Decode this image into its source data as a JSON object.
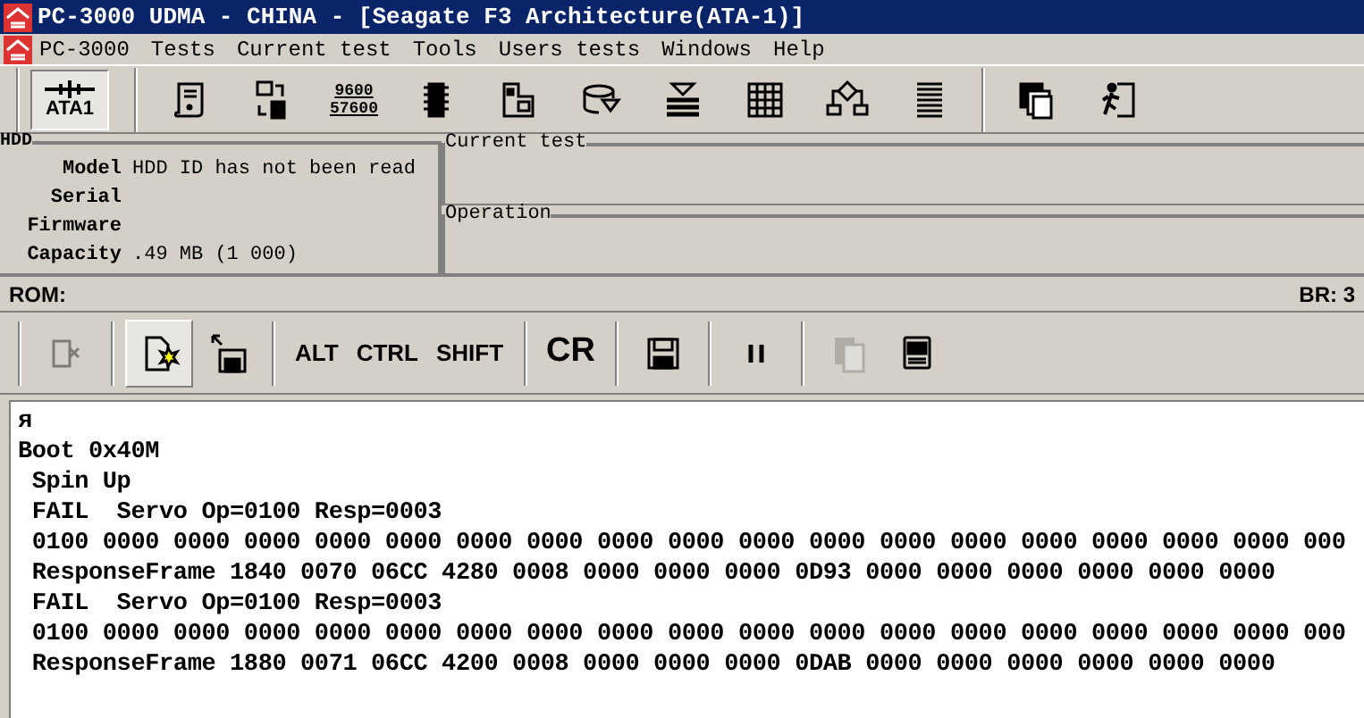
{
  "window": {
    "title": "PC-3000 UDMA - CHINA - [Seagate F3 Architecture(ATA-1)]"
  },
  "menu": [
    "PC-3000",
    "Tests",
    "Current test",
    "Tools",
    "Users tests",
    "Windows",
    "Help"
  ],
  "toolbar": [
    {
      "kind": "port",
      "label": "ATA1",
      "selected": true
    },
    {
      "kind": "separator"
    },
    {
      "kind": "icon",
      "selected": false
    },
    {
      "kind": "icon",
      "selected": false
    },
    {
      "kind": "baud",
      "label": "9600",
      "label2": "57600",
      "selected": false
    },
    {
      "kind": "icon",
      "selected": false
    },
    {
      "kind": "icon",
      "selected": false
    },
    {
      "kind": "icon",
      "selected": false
    },
    {
      "kind": "icon",
      "selected": false
    },
    {
      "kind": "icon",
      "selected": false
    },
    {
      "kind": "icon",
      "selected": false
    },
    {
      "kind": "icon",
      "selected": false
    },
    {
      "kind": "separator"
    },
    {
      "kind": "icon",
      "selected": false
    },
    {
      "kind": "icon",
      "selected": false
    }
  ],
  "hdd": {
    "title": "HDD",
    "fields": [
      {
        "label": "Model",
        "value": "HDD ID has not been read"
      },
      {
        "label": "Serial"
      },
      {
        "label": "Firmware"
      },
      {
        "label": "Capacity",
        "value": ".49 MB (1 000)"
      }
    ]
  },
  "current_test": {
    "title": "Current test"
  },
  "operation": {
    "title": "Operation"
  },
  "status": {
    "rom": "ROM:",
    "br": "BR: 3"
  },
  "toolbar2": [
    {
      "kind": "separator"
    },
    {
      "kind": "icon",
      "selected": false,
      "disabled": true
    },
    {
      "kind": "separator"
    },
    {
      "kind": "icon",
      "selected": true,
      "disabled": false
    },
    {
      "kind": "icon",
      "selected": false,
      "disabled": false
    },
    {
      "kind": "separator"
    },
    {
      "kind": "text",
      "label": "ALT",
      "selected": false,
      "disabled": false
    },
    {
      "kind": "text",
      "label": "CTRL",
      "selected": false,
      "disabled": false
    },
    {
      "kind": "text",
      "label": "SHIFT",
      "selected": false,
      "disabled": false
    },
    {
      "kind": "separator"
    },
    {
      "kind": "big",
      "label": "CR",
      "selected": false,
      "disabled": false
    },
    {
      "kind": "separator"
    },
    {
      "kind": "icon",
      "selected": false,
      "disabled": false
    },
    {
      "kind": "separator"
    },
    {
      "kind": "icon",
      "selected": false,
      "disabled": false
    },
    {
      "kind": "separator"
    },
    {
      "kind": "icon",
      "selected": false,
      "disabled": true
    },
    {
      "kind": "icon",
      "selected": false,
      "disabled": false
    }
  ],
  "log": [
    "я",
    "Boot 0x40M",
    " Spin Up",
    " FAIL  Servo Op=0100 Resp=0003",
    " 0100 0000 0000 0000 0000 0000 0000 0000 0000 0000 0000 0000 0000 0000 0000 0000 0000 0000 000",
    " ResponseFrame 1840 0070 06CC 4280 0008 0000 0000 0000 0D93 0000 0000 0000 0000 0000 0000",
    " FAIL  Servo Op=0100 Resp=0003",
    " 0100 0000 0000 0000 0000 0000 0000 0000 0000 0000 0000 0000 0000 0000 0000 0000 0000 0000 000",
    " ResponseFrame 1880 0071 06CC 4200 0008 0000 0000 0000 0DAB 0000 0000 0000 0000 0000 0000"
  ]
}
